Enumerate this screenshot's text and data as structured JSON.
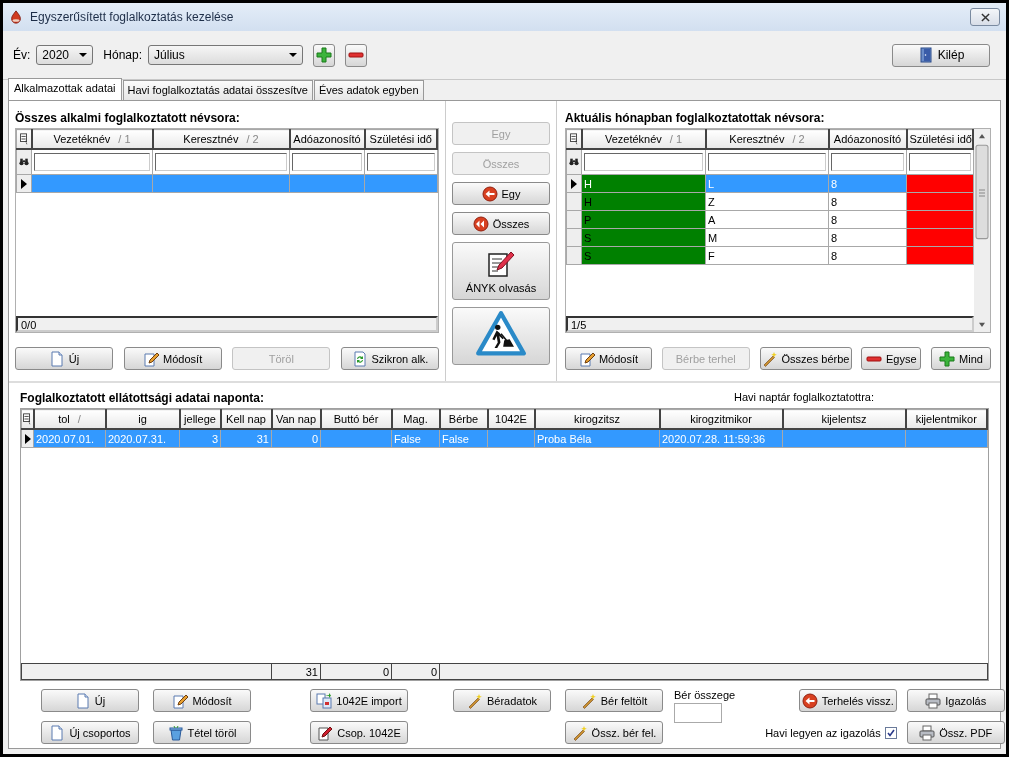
{
  "window": {
    "title": "Egyszerűsített foglalkoztatás kezelése"
  },
  "toolbar": {
    "year": {
      "label": "Év:",
      "value": "2020"
    },
    "month": {
      "label": "Hónap:",
      "value": "Július"
    },
    "exit_button": "Kilép"
  },
  "tabs": [
    {
      "label": "Alkalmazottak adatai",
      "selected": true
    },
    {
      "label": "Havi foglalkoztatás adatai összesítve",
      "selected": false
    },
    {
      "label": "Éves adatok egyben",
      "selected": false
    }
  ],
  "all_employees": {
    "title": "Összes alkalmi foglalkoztatott névsora:",
    "columns": [
      {
        "label": "Vezetéknév",
        "sort": "/ 1"
      },
      {
        "label": "Keresztnév",
        "sort": "/ 2"
      },
      {
        "label": "Adóazonosító"
      },
      {
        "label": "Születési idő"
      }
    ],
    "rows": [
      {
        "selected": true,
        "cells": []
      }
    ],
    "counter": "0/0",
    "buttons": [
      {
        "label": "Új",
        "kind": "document",
        "disabled": false
      },
      {
        "label": "Módosít",
        "kind": "pencil",
        "disabled": false
      },
      {
        "label": "Töröl",
        "kind": "plain",
        "disabled": true
      },
      {
        "label": "Szikron alk.",
        "kind": "refresh",
        "disabled": false
      }
    ]
  },
  "transfer_buttons": [
    {
      "label": "Egy",
      "disabled": true,
      "kind": "plain"
    },
    {
      "label": "Összes",
      "disabled": true,
      "kind": "plain"
    },
    {
      "label": "Egy",
      "kind": "back",
      "disabled": false
    },
    {
      "label": "Összes",
      "kind": "double-back",
      "disabled": false
    },
    {
      "label": "ÁNYK olvasás",
      "kind": "notepad",
      "disabled": false
    },
    {
      "kind": "roadwork",
      "disabled": false
    }
  ],
  "current_month": {
    "title": "Aktuális hónapban foglalkoztatottak névsora:",
    "columns": [
      {
        "label": "Vezetéknév",
        "sort": "/ 1",
        "color": "#008000"
      },
      {
        "label": "Keresztnév",
        "sort": "/ 2"
      },
      {
        "label": "Adóazonosító"
      },
      {
        "label": "Születési idő",
        "color": "#ff0000"
      }
    ],
    "rows": [
      {
        "selected": true,
        "cells": [
          "H",
          "L",
          "8"
        ]
      },
      {
        "selected": false,
        "cells": [
          "H",
          "Z",
          "8"
        ]
      },
      {
        "selected": false,
        "cells": [
          "P",
          "A",
          "8"
        ]
      },
      {
        "selected": false,
        "cells": [
          "S",
          "M",
          "8"
        ]
      },
      {
        "selected": false,
        "cells": [
          "S",
          "F",
          "8"
        ]
      }
    ],
    "counter": "1/5",
    "buttons": [
      {
        "label": "Módosít",
        "kind": "pencil",
        "disabled": false
      },
      {
        "label": "Bérbe terhel",
        "kind": "plain",
        "disabled": true
      },
      {
        "label": "Összes bérbe",
        "kind": "wand",
        "disabled": false
      },
      {
        "label": "Egyse",
        "kind": "minus",
        "disabled": false
      },
      {
        "label": "Mind",
        "kind": "plus",
        "disabled": false
      }
    ]
  },
  "daily_data": {
    "title": "Foglalkoztatott ellátottsági adatai naponta:",
    "calendar_label": "Havi naptár foglalkoztatottra:",
    "columns": [
      {
        "label": "tol",
        "sort": "/"
      },
      {
        "label": "ig"
      },
      {
        "label": "jellege",
        "kind": "number"
      },
      {
        "label": "Kell nap",
        "kind": "number"
      },
      {
        "label": "Van nap",
        "kind": "number"
      },
      {
        "label": "Buttó bér",
        "kind": "number"
      },
      {
        "label": "Mag."
      },
      {
        "label": "Bérbe"
      },
      {
        "label": "1042E"
      },
      {
        "label": "kirogzitsz"
      },
      {
        "label": "kirogzitmikor"
      },
      {
        "label": "kijelentsz"
      },
      {
        "label": "kijelentmikor"
      }
    ],
    "rows": [
      {
        "selected": true,
        "cells": [
          "2020.07.01.",
          "2020.07.31.",
          "3",
          "31",
          "0",
          "",
          "False",
          "False",
          "",
          "Proba Béla",
          "2020.07.28. 11:59:36",
          "",
          ""
        ]
      }
    ],
    "totals": [
      "31",
      "0",
      "0"
    ]
  },
  "bottom_controls": [
    [
      {
        "kind": "document",
        "label": "Új"
      },
      {
        "kind": "document",
        "label": "Új csoportos"
      }
    ],
    [
      {
        "kind": "pencil",
        "label": "Módosít"
      },
      {
        "kind": "bin",
        "label": "Tétel töröl"
      }
    ],
    [
      {
        "kind": "import",
        "label": "1042E import"
      },
      {
        "kind": "pen-paper",
        "label": "Csop. 1042E"
      }
    ],
    [
      {
        "kind": "wand",
        "label": "Béradatok"
      }
    ],
    [
      {
        "kind": "wand",
        "label": "Bér feltölt"
      },
      {
        "kind": "wand",
        "label": "Össz. bér fel."
      }
    ],
    [
      {
        "kind": "field",
        "label": "Bér összege"
      }
    ],
    [
      {
        "kind": "back",
        "label": "Terhelés vissz."
      },
      {
        "kind": "checkbox",
        "label": "Havi legyen az igazolás",
        "checked": true
      }
    ],
    [
      {
        "kind": "printer",
        "label": "Igazolás"
      },
      {
        "kind": "printer",
        "label": "Össz. PDF"
      }
    ]
  ]
}
